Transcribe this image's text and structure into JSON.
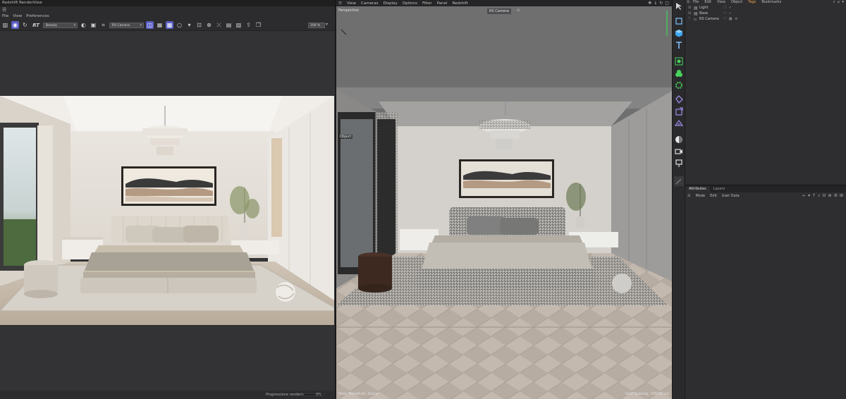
{
  "renderview": {
    "title": "Redshift RenderView",
    "menu": [
      "File",
      "View",
      "Preferences"
    ],
    "toolbar": {
      "aov_select": "Beauty",
      "camera_select": "RS Camera",
      "rt_label": "RT",
      "zoom": "100 %"
    },
    "status": {
      "progress_label": "Progressione rendering",
      "progress_value": "0%",
      "progress_fraction": 0.0
    }
  },
  "viewport": {
    "menu": [
      "View",
      "Cameras",
      "Display",
      "Options",
      "Filter",
      "Panel",
      "Redshift"
    ],
    "label": "Perspective",
    "camera": "RS Camera",
    "object_tag": "Object",
    "hud_left": "View Transform: Scene",
    "hud_right": "Grid Spacing : 50000 cm"
  },
  "object_manager": {
    "menu": [
      "File",
      "Edit",
      "View",
      "Object",
      "Tags",
      "Bookmarks"
    ],
    "objects": [
      {
        "name": "Light"
      },
      {
        "name": "Base"
      },
      {
        "name": "RS Camera"
      }
    ]
  },
  "attributes": {
    "tabs": [
      "Attributes",
      "Layers"
    ],
    "toolbar": [
      "Mode",
      "Edit",
      "User Data"
    ]
  },
  "icons": {
    "tool_column": [
      "cursor-icon",
      "cube-outline-icon",
      "cube-icon",
      "text-icon",
      "cloner-icon",
      "deformer-icon",
      "generator-icon",
      "tag-icon",
      "spline-icon",
      "field-icon",
      "material-icon",
      "camera-icon",
      "light-icon"
    ]
  },
  "colors": {
    "accent": "#5b5fc4",
    "tags_menu": "#f2a24a",
    "panel_bg": "#2e2e30"
  }
}
